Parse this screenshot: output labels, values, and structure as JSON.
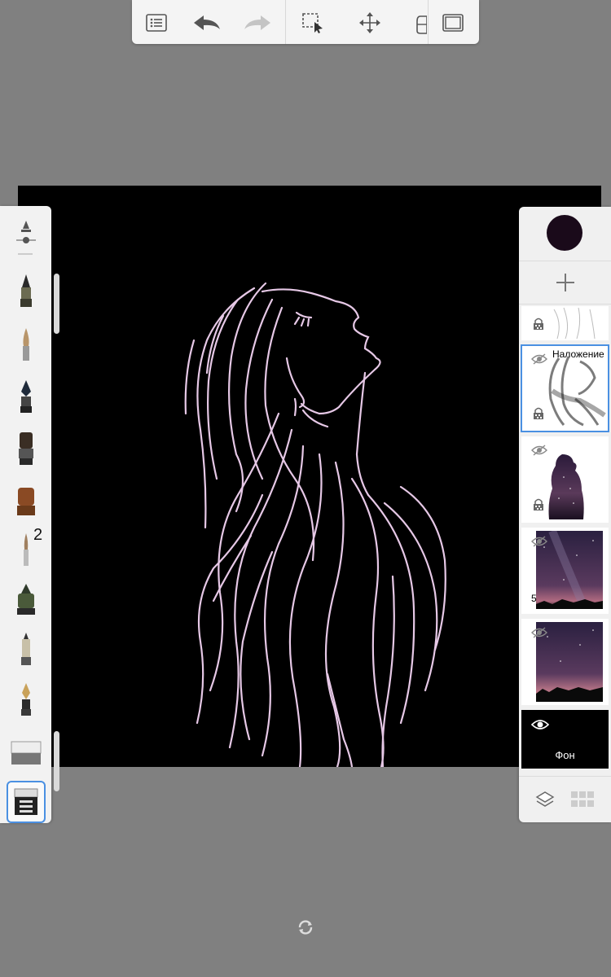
{
  "toolbar": {
    "icons": [
      "list-icon",
      "undo-icon",
      "redo-icon",
      "selection-icon",
      "transform-icon",
      "bucket-icon",
      "fullscreen-icon"
    ]
  },
  "brushes": {
    "items": [
      "marker",
      "brush-pointed",
      "ballpoint-pen",
      "paint-brush-flat",
      "airbrush",
      "fine-brush",
      "inking-pen",
      "pencil-mechanical",
      "fountain-pen",
      "eraser-soft",
      "eraser-hard"
    ],
    "selected": "eraser-hard",
    "count_badge": "2"
  },
  "colors": {
    "current_color": "#1a0a1a",
    "line_color": "#e6c8e6",
    "accent": "#4a90e2"
  },
  "layers": {
    "items": [
      {
        "kind": "sketch",
        "mode": "",
        "opacity": "",
        "name": ""
      },
      {
        "kind": "overlay-face",
        "mode": "Наложение",
        "opacity": "",
        "name": ""
      },
      {
        "kind": "galaxy-silhouette",
        "mode": "",
        "opacity": "",
        "name": ""
      },
      {
        "kind": "galaxy-sky",
        "mode": "",
        "opacity": "5",
        "name": ""
      },
      {
        "kind": "galaxy-sky-2",
        "mode": "",
        "opacity": "",
        "name": ""
      },
      {
        "kind": "background",
        "mode": "",
        "opacity": "",
        "name": "Фон"
      }
    ],
    "active_index": 1
  }
}
